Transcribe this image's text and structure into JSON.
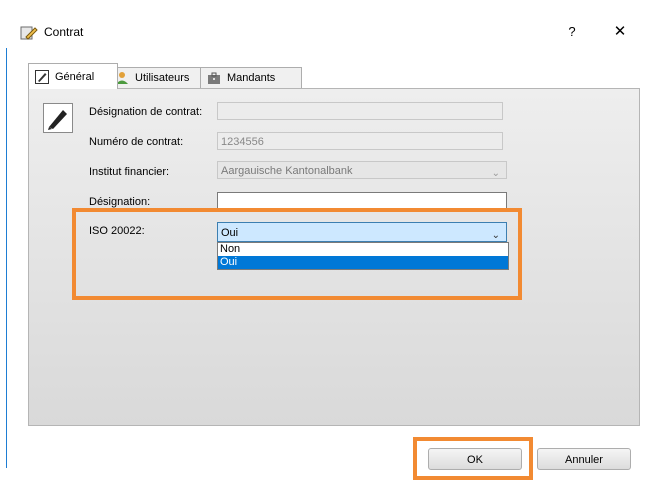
{
  "window": {
    "title": "Contrat",
    "help_label": "?",
    "close_label": "✕"
  },
  "tabs": [
    {
      "label": "Général",
      "icon": "pen-icon",
      "active": true
    },
    {
      "label": "Utilisateurs",
      "icon": "user-icon",
      "active": false
    },
    {
      "label": "Mandants",
      "icon": "briefcase-icon",
      "active": false
    }
  ],
  "form": {
    "designation_contrat": {
      "label": "Désignation de contrat:",
      "value": ""
    },
    "numero_contrat": {
      "label": "Numéro de contrat:",
      "value": "1234556"
    },
    "institut_financier": {
      "label": "Institut financier:",
      "value": "Aargauische Kantonalbank"
    },
    "designation": {
      "label": "Désignation:",
      "value": ""
    },
    "iso20022": {
      "label": "ISO 20022:",
      "value": "Oui",
      "options": [
        "Non",
        "Oui"
      ],
      "selected_option": "Oui"
    }
  },
  "buttons": {
    "ok": "OK",
    "cancel": "Annuler"
  },
  "colors": {
    "highlight": "#f28a32",
    "selection": "#0078d7",
    "window_border": "#1e7dd3"
  }
}
